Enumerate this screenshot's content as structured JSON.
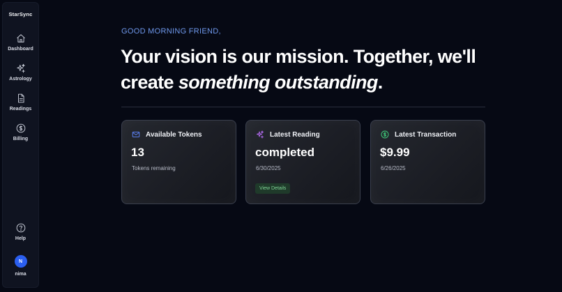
{
  "app": {
    "logo": "StarSync"
  },
  "sidebar": {
    "items": [
      {
        "label": "Dashboard",
        "icon": "home-icon"
      },
      {
        "label": "Astrology",
        "icon": "sparkles-icon"
      },
      {
        "label": "Readings",
        "icon": "document-icon"
      },
      {
        "label": "Billing",
        "icon": "dollar-icon"
      }
    ],
    "help": {
      "label": "Help",
      "icon": "help-icon"
    },
    "user": {
      "initial": "N",
      "name": "nima"
    }
  },
  "main": {
    "greeting": "GOOD MORNING FRIEND,",
    "headline_part1": "Your vision is our mission. Together, we'll create ",
    "headline_emphasis": "something outstanding",
    "headline_end": "."
  },
  "cards": [
    {
      "title": "Available Tokens",
      "value": "13",
      "sub": "Tokens remaining",
      "icon": "mail-icon",
      "icon_color": "#5a7ff0"
    },
    {
      "title": "Latest Reading",
      "value": "completed",
      "sub": "6/30/2025",
      "button": "View Details",
      "icon": "sparkles-icon",
      "icon_color": "#b36bf0"
    },
    {
      "title": "Latest Transaction",
      "value": "$9.99",
      "sub": "6/26/2025",
      "icon": "dollar-icon",
      "icon_color": "#3ec878"
    }
  ]
}
